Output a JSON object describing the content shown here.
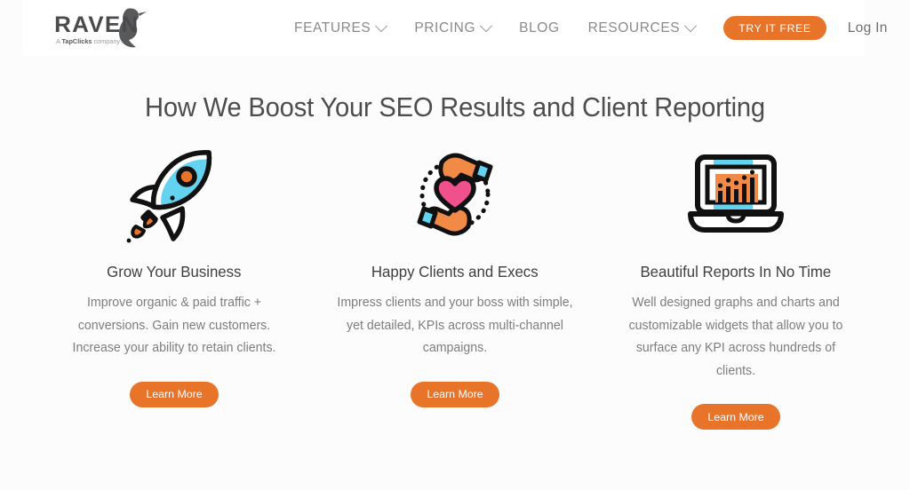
{
  "brand": {
    "logo_wordmark": "RAVEN",
    "logo_tagline_prefix": "A ",
    "logo_tagline_bold": "TapClicks",
    "logo_tagline_suffix": " company",
    "accent_orange": "#e8742a",
    "icon_cyan": "#63d3ef",
    "icon_pink": "#f0508c",
    "icon_black": "#111111"
  },
  "nav": {
    "items": [
      {
        "label": "FEATURES",
        "has_dropdown": true
      },
      {
        "label": "PRICING",
        "has_dropdown": true
      },
      {
        "label": "BLOG",
        "has_dropdown": false
      },
      {
        "label": "RESOURCES",
        "has_dropdown": true
      }
    ],
    "cta_label": "TRY IT FREE",
    "login_label": "Log In"
  },
  "main": {
    "heading": "How We Boost Your SEO Results and Client Reporting",
    "cards": [
      {
        "icon": "rocket-icon",
        "title": "Grow Your Business",
        "body": "Improve organic & paid traffic + conversions. Gain new customers. Increase your ability to retain clients.",
        "button_label": "Learn More"
      },
      {
        "icon": "hands-heart-icon",
        "title": "Happy Clients and Execs",
        "body": "Impress clients and your boss with simple, yet detailed, KPIs across multi-channel campaigns.",
        "button_label": "Learn More"
      },
      {
        "icon": "laptop-chart-icon",
        "title": "Beautiful Reports In No Time",
        "body": "Well designed graphs and charts and customizable widgets that allow you to surface any KPI across hundreds of clients.",
        "button_label": "Learn More"
      }
    ]
  }
}
